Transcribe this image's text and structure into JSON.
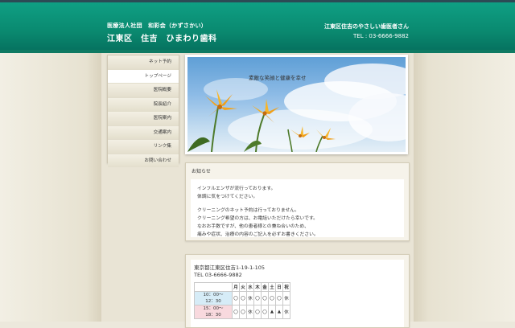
{
  "header": {
    "org": "医療法人社団　和彩会（かずさかい）",
    "clinic_name": "江東区　住吉　ひまわり歯科",
    "tagline": "江東区住吉のやさしい歯医者さん",
    "tel": "TEL : 03-6666-9882"
  },
  "nav": {
    "items": [
      {
        "label": "ネット予約"
      },
      {
        "label": "トップページ"
      },
      {
        "label": "医院概要"
      },
      {
        "label": "院長紹介"
      },
      {
        "label": "医院案内"
      },
      {
        "label": "交通案内"
      },
      {
        "label": "リンク集"
      },
      {
        "label": "お問い合わせ"
      }
    ],
    "active_index": 1
  },
  "hero": {
    "caption": "素敵な笑顔と健康を幸せ"
  },
  "news": {
    "title": "お知らせ",
    "lines": [
      "インフルエンザが流行っております。",
      "体調に気をつけてください。",
      "",
      "クリーニングのネット予約は行っておりません。",
      "クリーニング希望の方は、お電話いただけたら幸いです。",
      "なおお手数ですが、他の患者様との兼ね合いのため、",
      "痛みや症状、治療の内容のご記入を必ずお書きください。"
    ]
  },
  "access": {
    "address": "東京都江東区住吉1-19-1-105",
    "phone": "TEL 03-6666-9882",
    "schedule": {
      "days": [
        "月",
        "火",
        "水",
        "木",
        "金",
        "土",
        "日",
        "祝"
      ],
      "rows": [
        {
          "time_start": "10：00～",
          "time_end": "12：30",
          "marks": [
            "〇",
            "〇",
            "休",
            "〇",
            "〇",
            "〇",
            "〇",
            "休"
          ]
        },
        {
          "time_start": "15：00～",
          "time_end": "18：30",
          "marks": [
            "〇",
            "〇",
            "休",
            "〇",
            "〇",
            "▲",
            "▲",
            "休"
          ]
        }
      ]
    }
  },
  "colors": {
    "header_green": "#0a8a70",
    "page_bg": "#ece8dc",
    "am_row": "#d6ecf7",
    "pm_row": "#f8d9de"
  }
}
